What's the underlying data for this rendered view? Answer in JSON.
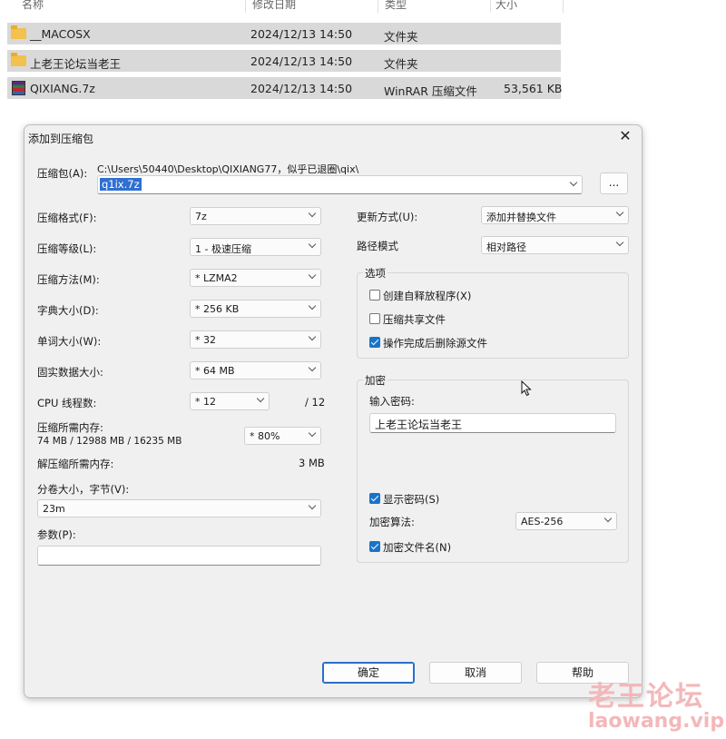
{
  "file_list": {
    "columns": [
      "名称",
      "修改日期",
      "类型",
      "大小"
    ],
    "rows": [
      {
        "name": "__MACOSX",
        "date": "2024/12/13 14:50",
        "type": "文件夹",
        "size": "",
        "icon": "folder-icon"
      },
      {
        "name": "上老王论坛当老王",
        "date": "2024/12/13 14:50",
        "type": "文件夹",
        "size": "",
        "icon": "folder-icon"
      },
      {
        "name": "QIXIANG.7z",
        "date": "2024/12/13 14:50",
        "type": "WinRAR 压缩文件",
        "size": "53,561 KB",
        "icon": "winrar-archive-icon"
      }
    ]
  },
  "dialog": {
    "title": "添加到压缩包",
    "close_glyph": "✕",
    "archive_label": "压缩包(A):",
    "archive_path": "C:\\Users\\50440\\Desktop\\QIXIANG77，似乎已退圈\\qix\\",
    "archive_name": "q1ix.7z",
    "browse_label": "...",
    "format_label": "压缩格式(F):",
    "format_value": "7z",
    "level_label": "压缩等级(L):",
    "level_value": "1 - 极速压缩",
    "method_label": "压缩方法(M):",
    "method_value": "* LZMA2",
    "dict_label": "字典大小(D):",
    "dict_value": "* 256 KB",
    "word_label": "单词大小(W):",
    "word_value": "* 32",
    "solid_label": "固实数据大小:",
    "solid_value": "* 64 MB",
    "threads_label": "CPU 线程数:",
    "threads_value": "* 12",
    "threads_total": "/ 12",
    "mem_comp_label": "压缩所需内存:",
    "mem_comp_detail": "74 MB / 12988 MB / 16235 MB",
    "mem_comp_value": "* 80%",
    "mem_decomp_label": "解压缩所需内存:",
    "mem_decomp_value": "3 MB",
    "volume_label": "分卷大小，字节(V):",
    "volume_value": "23m",
    "params_label": "参数(P):",
    "params_value": "",
    "update_label": "更新方式(U):",
    "update_value": "添加并替换文件",
    "path_mode_label": "路径模式",
    "path_mode_value": "相对路径",
    "options_title": "选项",
    "opt_sfx": "创建自释放程序(X)",
    "opt_shared": "压缩共享文件",
    "opt_delete": "操作完成后删除源文件",
    "encrypt_title": "加密",
    "password_label": "输入密码:",
    "password_value": "上老王论坛当老王",
    "show_password": "显示密码(S)",
    "enc_method_label": "加密算法:",
    "enc_method_value": "AES-256",
    "enc_names": "加密文件名(N)",
    "ok": "确定",
    "cancel": "取消",
    "help": "帮助"
  },
  "watermark": {
    "line1": "老王论坛",
    "line2": "laowang.vip"
  }
}
